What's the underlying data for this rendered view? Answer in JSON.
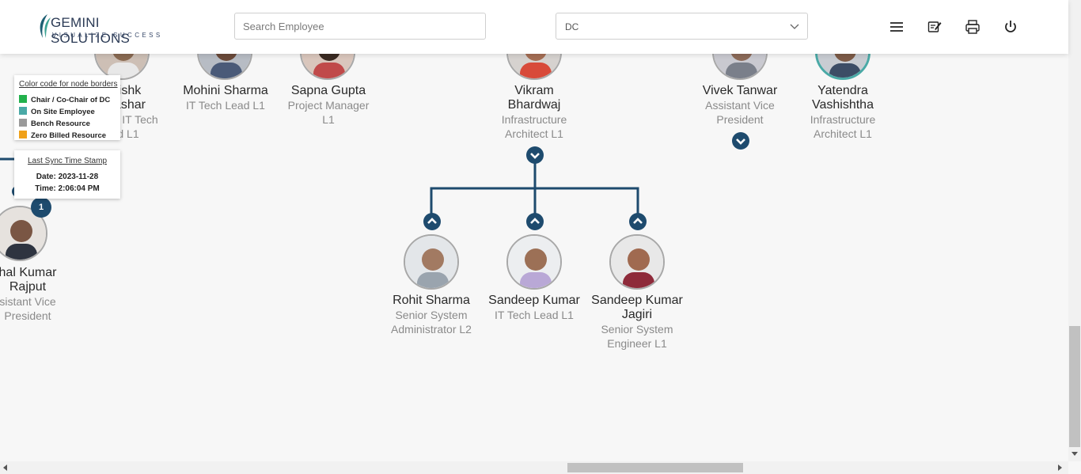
{
  "header": {
    "logo_title": "GEMINI SOLUTIONS",
    "logo_tagline": "VISUALIZE SUCCESS",
    "search_placeholder": "Search Employee",
    "dept_selected": "DC",
    "icons": [
      "menu-icon",
      "edit-note-icon",
      "print-icon",
      "power-icon"
    ]
  },
  "legend": {
    "title": "Color code for node borders",
    "items": [
      {
        "label": "Chair / Co-Chair of DC",
        "color": "#22b14c"
      },
      {
        "label": "On Site Employee",
        "color": "#4aa9a6"
      },
      {
        "label": "Bench Resource",
        "color": "#9a9a9a"
      },
      {
        "label": "Zero Billed Resource",
        "color": "#f0a11a"
      }
    ]
  },
  "sync": {
    "title": "Last Sync Time Stamp",
    "date": "Date: 2023-11-28",
    "time": "Time: 2:06:04 PM"
  },
  "left_node": {
    "name_line1": "hal Kumar",
    "name_line2": "Rajput",
    "desig_line1": "sistant Vice",
    "desig_line2": "President",
    "badge": "1"
  },
  "top_nodes": [
    {
      "name_lines": [
        "ishk",
        "ashar"
      ],
      "desig_lines": [
        "IT Tech",
        "d L1"
      ]
    },
    {
      "name_lines": [
        "Mohini Sharma"
      ],
      "desig_lines": [
        "IT Tech Lead L1"
      ]
    },
    {
      "name_lines": [
        "Sapna Gupta"
      ],
      "desig_lines": [
        "Project Manager",
        "L1"
      ]
    },
    {
      "name_lines": [
        "Vikram",
        "Bhardwaj"
      ],
      "desig_lines": [
        "Infrastructure",
        "Architect L1"
      ]
    },
    {
      "name_lines": [
        "Vivek Tanwar"
      ],
      "desig_lines": [
        "Assistant Vice",
        "President"
      ]
    },
    {
      "name_lines": [
        "Yatendra",
        "Vashishtha"
      ],
      "desig_lines": [
        "Infrastructure",
        "Architect L1"
      ]
    }
  ],
  "child_nodes": [
    {
      "name_lines": [
        "Rohit Sharma"
      ],
      "desig_lines": [
        "Senior System",
        "Administrator L2"
      ]
    },
    {
      "name_lines": [
        "Sandeep Kumar"
      ],
      "desig_lines": [
        "IT Tech Lead L1"
      ]
    },
    {
      "name_lines": [
        "Sandeep Kumar",
        "Jagiri"
      ],
      "desig_lines": [
        "Senior System",
        "Engineer L1"
      ]
    }
  ],
  "colors": {
    "accent": "#1e4b6e",
    "onsite_border": "#4aa9a6",
    "default_border": "#a8a8a8"
  }
}
